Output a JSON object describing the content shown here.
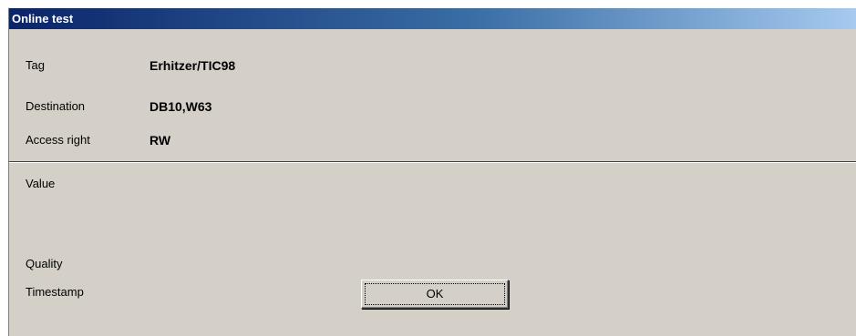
{
  "dialog": {
    "title": "Online test"
  },
  "info": {
    "tag_label": "Tag",
    "tag_value": "Erhitzer/TIC98",
    "destination_label": "Destination",
    "destination_value": "DB10,W63",
    "access_label": "Access right",
    "access_value": "RW"
  },
  "status": {
    "value_label": "Value",
    "quality_label": "Quality",
    "timestamp_label": "Timestamp"
  },
  "buttons": {
    "ok_label": "OK"
  }
}
